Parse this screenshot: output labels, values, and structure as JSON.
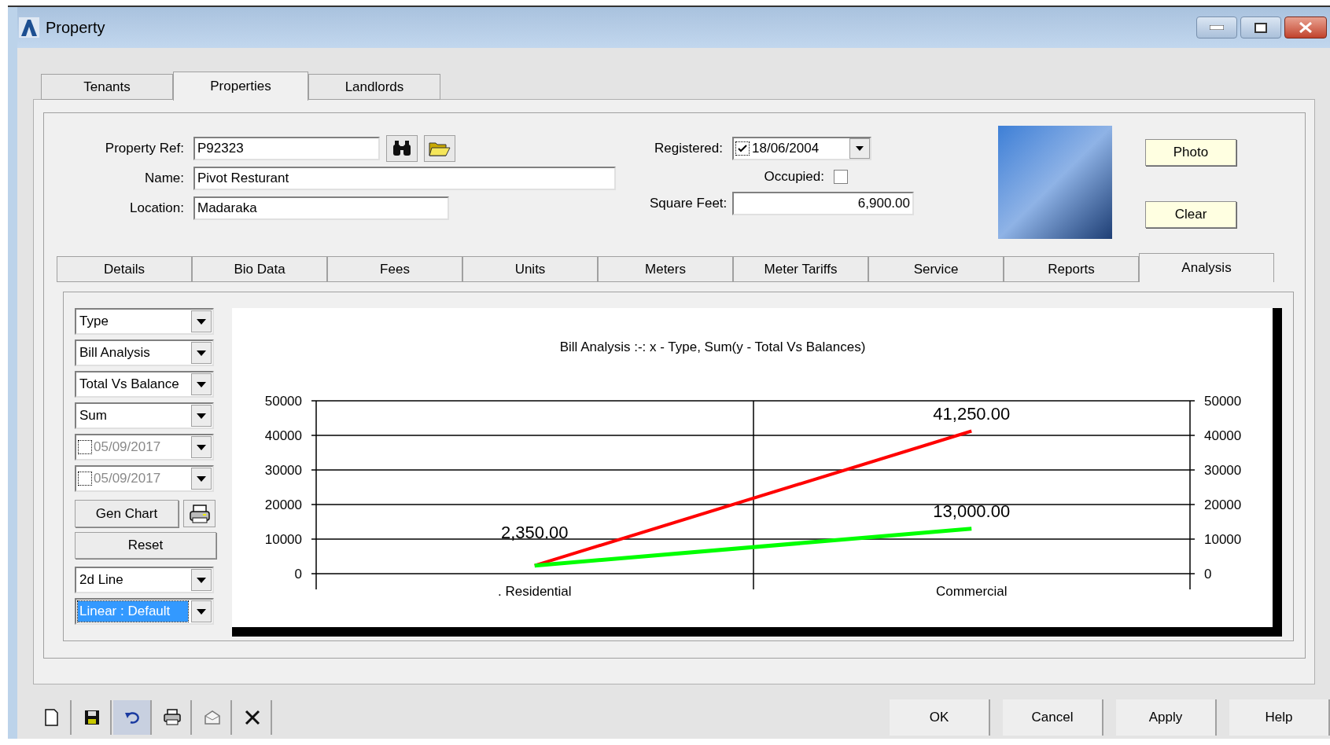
{
  "window": {
    "title": "Property"
  },
  "top_tabs": [
    {
      "label": "Tenants",
      "selected": false
    },
    {
      "label": "Properties",
      "selected": true
    },
    {
      "label": "Landlords",
      "selected": false
    }
  ],
  "form": {
    "property_ref": {
      "label": "Property Ref:",
      "value": "P92323"
    },
    "name": {
      "label": "Name:",
      "value": "Pivot Resturant"
    },
    "location": {
      "label": "Location:",
      "value": "Madaraka"
    },
    "registered": {
      "label": "Registered:",
      "value": "18/06/2004",
      "checked": true
    },
    "occupied": {
      "label": "Occupied:",
      "checked": false
    },
    "square_feet": {
      "label": "Square Feet:",
      "value": "6,900.00"
    }
  },
  "photo_buttons": [
    "Photo",
    "Clear"
  ],
  "detail_tabs": [
    {
      "label": "Details",
      "selected": false
    },
    {
      "label": "Bio Data",
      "selected": false
    },
    {
      "label": "Fees",
      "selected": false
    },
    {
      "label": "Units",
      "selected": false
    },
    {
      "label": "Meters",
      "selected": false
    },
    {
      "label": "Meter Tariffs",
      "selected": false
    },
    {
      "label": "Service",
      "selected": false
    },
    {
      "label": "Reports",
      "selected": false
    },
    {
      "label": "Analysis",
      "selected": true
    }
  ],
  "analysis": {
    "controls": [
      {
        "kind": "dropdown",
        "value": "Type",
        "highlighted": false
      },
      {
        "kind": "dropdown",
        "value": "Bill Analysis",
        "highlighted": false
      },
      {
        "kind": "dropdown",
        "value": "Total Vs Balance",
        "highlighted": false
      },
      {
        "kind": "dropdown",
        "value": "Sum",
        "highlighted": false
      },
      {
        "kind": "date",
        "value": "05/09/2017",
        "checked": false,
        "disabled": true
      },
      {
        "kind": "date",
        "value": "05/09/2017",
        "checked": false,
        "disabled": true
      },
      {
        "kind": "button_print",
        "label": "Gen Chart"
      },
      {
        "kind": "button",
        "label": "Reset"
      },
      {
        "kind": "dropdown",
        "value": "2d Line",
        "highlighted": false
      },
      {
        "kind": "dropdown",
        "value": "Linear : Default",
        "highlighted": true
      }
    ],
    "chart_data": {
      "type": "line",
      "title": "Bill Analysis :-: x - Type, Sum(y - Total Vs Balances)",
      "categories": [
        ". Residential",
        "Commercial"
      ],
      "series": [
        {
          "color": "#ff0000",
          "values": [
            2350,
            41250
          ],
          "value_labels": [
            "2,350.00",
            "41,250.00"
          ]
        },
        {
          "color": "#00ff00",
          "values": [
            2350,
            13000
          ],
          "value_labels": [
            null,
            "13,000.00"
          ]
        }
      ],
      "grid": true,
      "ylim": [
        0,
        50000
      ],
      "yticks": [
        0,
        10000,
        20000,
        30000,
        40000,
        50000
      ],
      "annotations": [
        "0",
        "10000",
        "20000",
        "30000",
        "40000",
        "50000"
      ]
    }
  },
  "bottom_buttons": [
    "OK",
    "Cancel",
    "Apply",
    "Help"
  ]
}
